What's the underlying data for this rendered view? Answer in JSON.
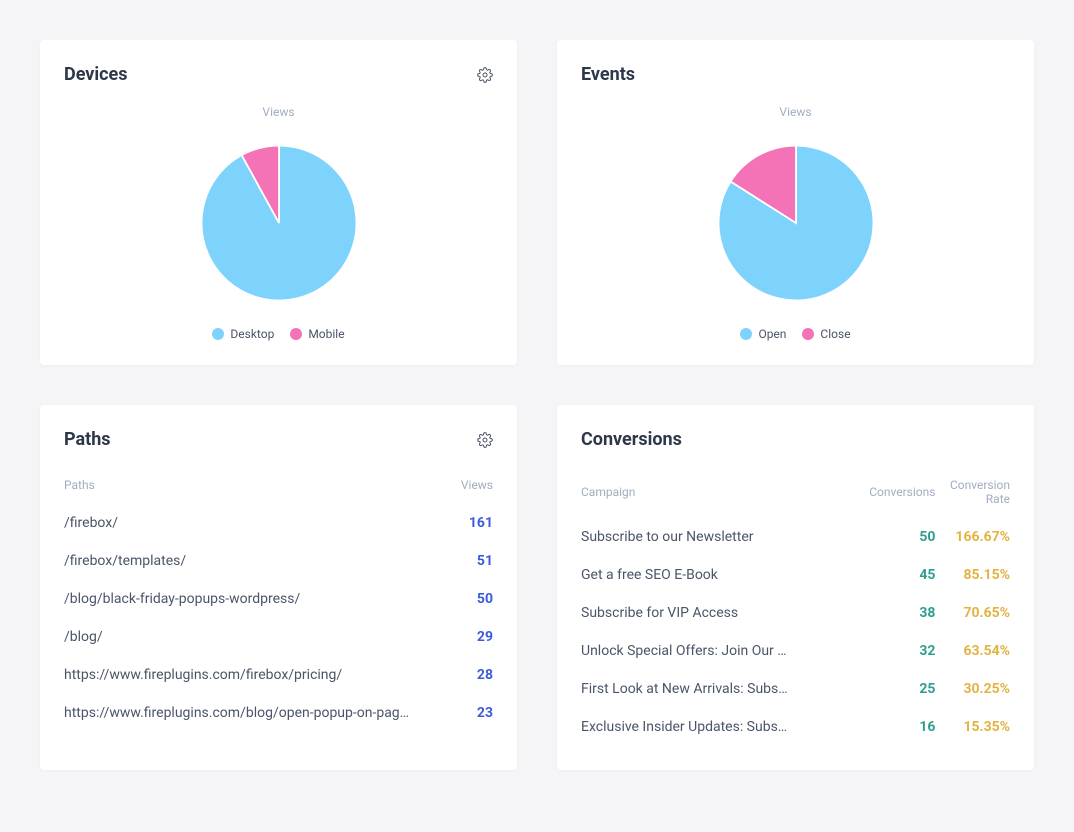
{
  "devices": {
    "title": "Devices",
    "subtitle": "Views",
    "legend": {
      "a": "Desktop",
      "b": "Mobile"
    }
  },
  "events": {
    "title": "Events",
    "subtitle": "Views",
    "legend": {
      "a": "Open",
      "b": "Close"
    }
  },
  "paths": {
    "title": "Paths",
    "col_a": "Paths",
    "col_b": "Views",
    "rows": [
      {
        "label": "/firebox/",
        "value": "161"
      },
      {
        "label": "/firebox/templates/",
        "value": "51"
      },
      {
        "label": "/blog/black-friday-popups-wordpress/",
        "value": "50"
      },
      {
        "label": "/blog/",
        "value": "29"
      },
      {
        "label": "https://www.fireplugins.com/firebox/pricing/",
        "value": "28"
      },
      {
        "label": "https://www.fireplugins.com/blog/open-popup-on-pag…",
        "value": "23"
      }
    ]
  },
  "conversions": {
    "title": "Conversions",
    "col_a": "Campaign",
    "col_b": "Conversions",
    "col_c": "Conversion Rate",
    "rows": [
      {
        "label": "Subscribe to our Newsletter",
        "conv": "50",
        "rate": "166.67%"
      },
      {
        "label": "Get a free SEO E-Book",
        "conv": "45",
        "rate": "85.15%"
      },
      {
        "label": "Subscribe for VIP Access",
        "conv": "38",
        "rate": "70.65%"
      },
      {
        "label": "Unlock Special Offers: Join Our …",
        "conv": "32",
        "rate": "63.54%"
      },
      {
        "label": "First Look at New Arrivals: Subs…",
        "conv": "25",
        "rate": "30.25%"
      },
      {
        "label": "Exclusive Insider Updates: Subs…",
        "conv": "16",
        "rate": "15.35%"
      }
    ]
  },
  "colors": {
    "blue": "#7dd3fc",
    "pink": "#f472b6"
  },
  "chart_data": [
    {
      "type": "pie",
      "title": "Devices — Views",
      "series": [
        {
          "name": "Desktop",
          "value": 92
        },
        {
          "name": "Mobile",
          "value": 8
        }
      ]
    },
    {
      "type": "pie",
      "title": "Events — Views",
      "series": [
        {
          "name": "Open",
          "value": 84
        },
        {
          "name": "Close",
          "value": 16
        }
      ]
    }
  ]
}
